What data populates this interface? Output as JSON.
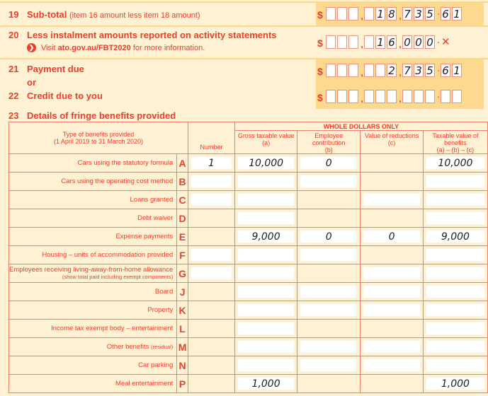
{
  "items": {
    "item19": {
      "number": "19",
      "label": "Sub-total",
      "note": "(item 16 amount less item 18 amount)",
      "amount": {
        "groups": [
          [
            "",
            "",
            ""
          ],
          [
            "",
            "1",
            "8"
          ],
          [
            "7",
            "3",
            "5"
          ]
        ],
        "cents": [
          "6",
          "1"
        ]
      }
    },
    "item20": {
      "number": "20",
      "label": "Less instalment amounts reported on activity statements",
      "info_prefix": "Visit",
      "info_link": "ato.gov.au/FBT2020",
      "info_suffix": "for more information.",
      "amount": {
        "groups": [
          [
            "",
            "",
            ""
          ],
          [
            "",
            "1",
            "6"
          ],
          [
            "0",
            "0",
            "0"
          ]
        ],
        "cents_mark": "✕"
      }
    },
    "item21": {
      "number": "21",
      "label": "Payment due",
      "amount": {
        "groups": [
          [
            "",
            "",
            ""
          ],
          [
            "",
            "",
            "2"
          ],
          [
            "7",
            "3",
            "5"
          ]
        ],
        "cents": [
          "6",
          "1"
        ]
      }
    },
    "or_label": "or",
    "item22": {
      "number": "22",
      "label": "Credit due to you",
      "amount": {
        "groups": [
          [
            "",
            "",
            ""
          ],
          [
            "",
            "",
            ""
          ],
          [
            "",
            "",
            ""
          ]
        ],
        "cents": [
          "",
          ""
        ]
      }
    },
    "item23": {
      "number": "23",
      "label": "Details of fringe benefits provided"
    }
  },
  "currency_symbol": "$",
  "thousands_sep": ",",
  "decimal_sep": "·",
  "table": {
    "type_header_line1": "Type of benefits provided",
    "type_header_line2": "(1 April 2019 to 31 March 2020)",
    "number_header": "Number",
    "group_header": "WHOLE DOLLARS ONLY",
    "columns": [
      {
        "line1": "Gross taxable value",
        "line2": "(a)"
      },
      {
        "line1": "Employee contribution",
        "line2": "(b)"
      },
      {
        "line1": "Value of reductions",
        "line2": "(c)"
      },
      {
        "line1": "Taxable value of benefits",
        "line2": "(a) – (b) – (c)"
      }
    ],
    "rows": [
      {
        "label": "Cars using the statutory formula",
        "letter": "A",
        "number": "1",
        "a": "10,000",
        "b": "0",
        "c": null,
        "total": "10,000"
      },
      {
        "label": "Cars using the operating cost method",
        "letter": "B",
        "number": "",
        "a": "",
        "b": "",
        "c": null,
        "total": ""
      },
      {
        "label": "Loans granted",
        "letter": "C",
        "number": "",
        "a": "",
        "b": null,
        "c": "",
        "total": ""
      },
      {
        "label": "Debt waiver",
        "letter": "D",
        "number": null,
        "a": "",
        "b": null,
        "c": null,
        "total": ""
      },
      {
        "label": "Expense payments",
        "letter": "E",
        "number": null,
        "a": "9,000",
        "b": "0",
        "c": "0",
        "total": "9,000"
      },
      {
        "label": "Housing – units of accommodation provided",
        "letter": "F",
        "number": "",
        "a": "",
        "b": "",
        "c": null,
        "total": ""
      },
      {
        "label": "Employees receiving living-away-from-home allowance",
        "sublabel": "(show total paid including exempt components)",
        "letter": "G",
        "number": "",
        "a": "",
        "b": null,
        "c": "",
        "total": ""
      },
      {
        "label": "Board",
        "letter": "J",
        "number": null,
        "a": "",
        "b": "",
        "c": "",
        "total": ""
      },
      {
        "label": "Property",
        "letter": "K",
        "number": null,
        "a": "",
        "b": "",
        "c": "",
        "total": ""
      },
      {
        "label": "Income tax exempt body – entertainment",
        "letter": "L",
        "number": null,
        "a": "",
        "b": null,
        "c": null,
        "total": ""
      },
      {
        "label": "Other benefits",
        "sublabel": "(residual)",
        "letter": "M",
        "number": null,
        "a": "",
        "b": "",
        "c": "",
        "total": ""
      },
      {
        "label": "Car parking",
        "letter": "N",
        "number": null,
        "a": "",
        "b": "",
        "c": "",
        "total": ""
      },
      {
        "label": "Meal entertainment",
        "letter": "P",
        "number": null,
        "a": "1,000",
        "b": null,
        "c": null,
        "total": "1,000"
      }
    ]
  }
}
